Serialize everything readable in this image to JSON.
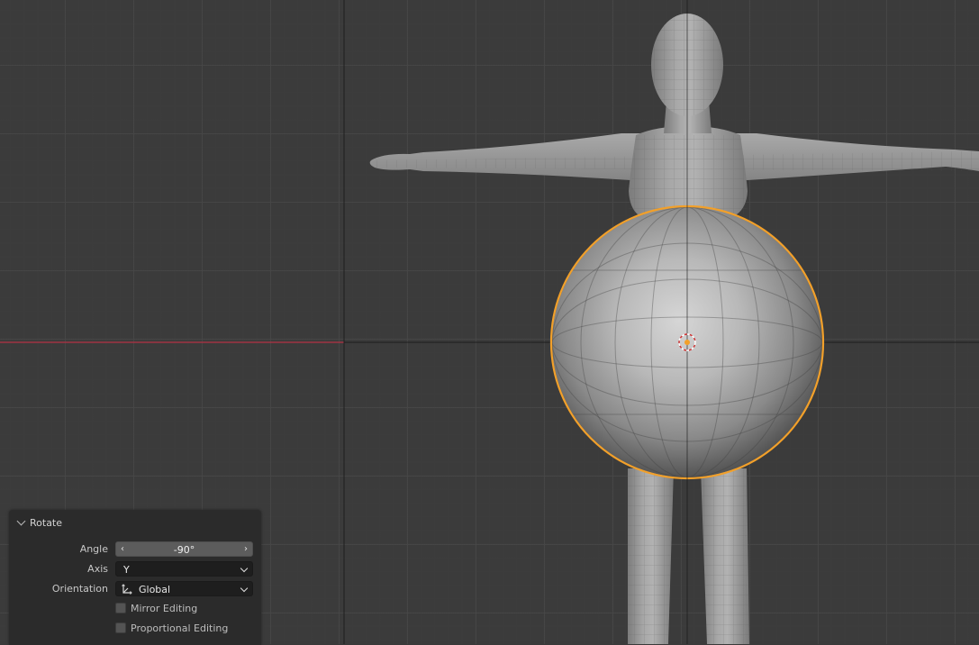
{
  "app": "Blender 3D Viewport",
  "viewport": {
    "grid_color": "#464646",
    "background_color": "#3b3b3b",
    "x_axis_color": "#b33244",
    "selection_outline_color": "#f2a02a",
    "objects": [
      {
        "name": "mannequin",
        "selected": false
      },
      {
        "name": "uv-sphere",
        "selected": true
      }
    ]
  },
  "operator_panel": {
    "title": "Rotate",
    "collapse_icon": "chevron-down-icon",
    "angle": {
      "label": "Angle",
      "value": "-90°"
    },
    "axis": {
      "label": "Axis",
      "value": "Y"
    },
    "orientation": {
      "label": "Orientation",
      "value": "Global",
      "icon": "orientation-global-icon"
    },
    "mirror_editing": {
      "label": "Mirror Editing",
      "checked": false
    },
    "proportional_editing": {
      "label": "Proportional Editing",
      "checked": false
    }
  }
}
